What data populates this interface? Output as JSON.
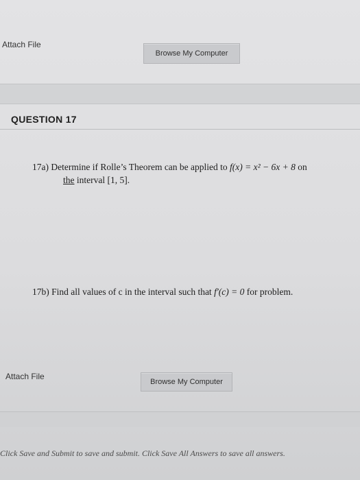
{
  "top_attach": {
    "label": "Attach File",
    "button": "Browse My Computer"
  },
  "question": {
    "title": "QUESTION 17",
    "part_a": {
      "prefix": "17a) Determine if Rolle’s Theorem can be applied to ",
      "function": "f(x) = x² − 6x + 8",
      "suffix": " on",
      "line2_the": "the",
      "line2_rest": " interval [1, 5]."
    },
    "part_b": {
      "prefix": "17b) Find all values of c in the interval such that ",
      "expr": "f′(c) = 0",
      "suffix": " for problem."
    }
  },
  "bottom_attach": {
    "label": "Attach File",
    "button": "Browse My Computer"
  },
  "footer": {
    "text": "Click Save and Submit to save and submit. Click Save All Answers to save all answers."
  }
}
